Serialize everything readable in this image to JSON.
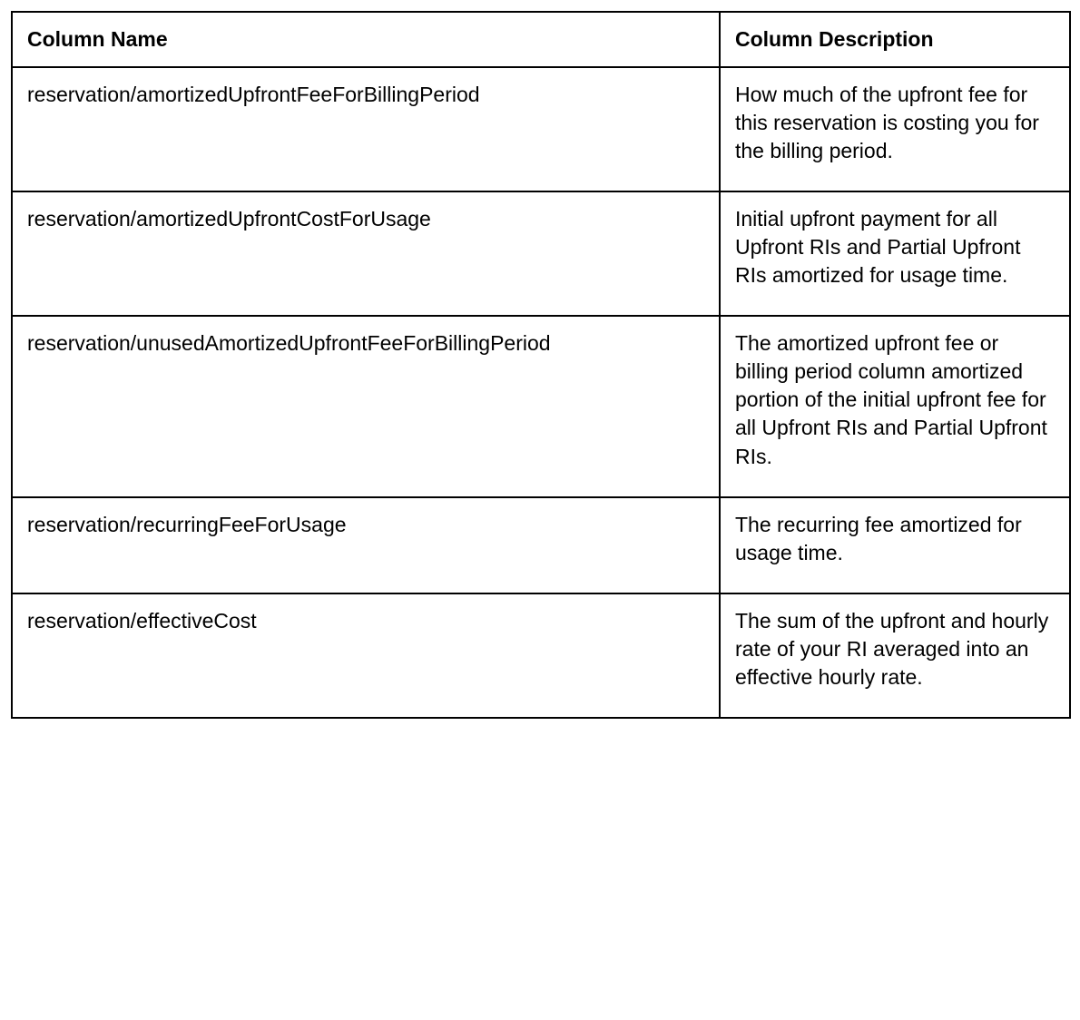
{
  "table": {
    "headers": {
      "col_name": "Column Name",
      "col_desc": "Column Description"
    },
    "rows": [
      {
        "name": "reservation/amortizedUpfrontFeeForBillingPeriod",
        "desc": "How much of the upfront fee for this reservation is costing you for the billing period."
      },
      {
        "name": "reservation/amortizedUpfrontCostForUsage",
        "desc": "Initial upfront payment for all Upfront RIs and Partial Upfront RIs amortized for usage time."
      },
      {
        "name": "reservation/unusedAmortizedUpfrontFeeForBillingPeriod",
        "desc": "The amortized upfront fee or billing period column amortized portion of the initial upfront fee for all Upfront RIs and Partial Upfront RIs."
      },
      {
        "name": "reservation/recurringFeeForUsage",
        "desc": "The recurring fee amortized for usage time."
      },
      {
        "name": "reservation/effectiveCost",
        "desc": "The sum of the upfront and hourly rate of your RI averaged into an effective hourly rate."
      }
    ]
  }
}
